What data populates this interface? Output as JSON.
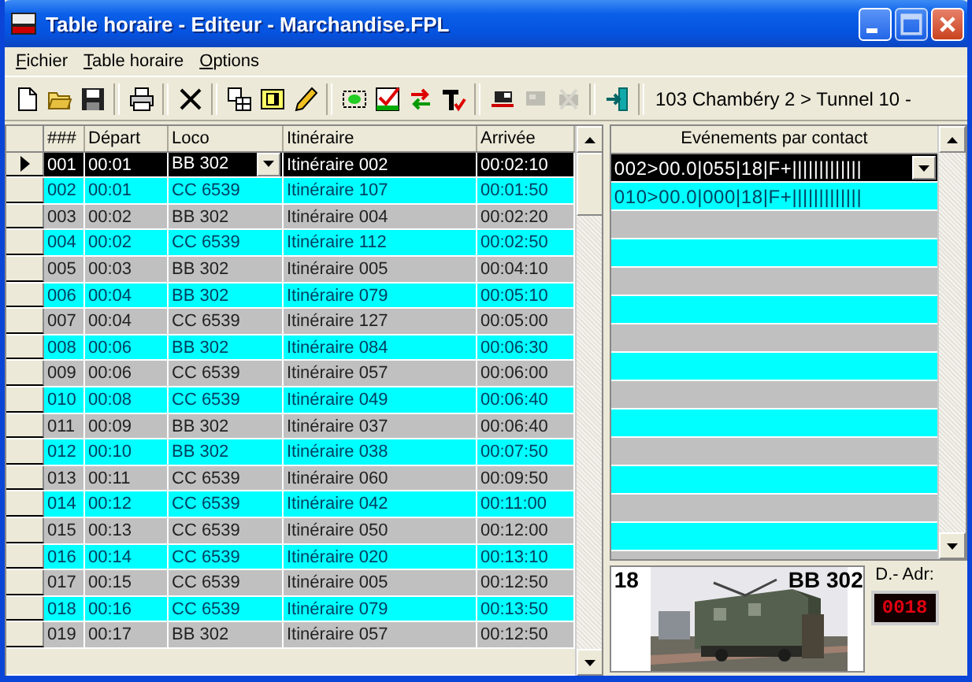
{
  "window": {
    "title": "Table horaire - Editeur - Marchandise.FPL"
  },
  "menu": [
    {
      "label": "Fichier"
    },
    {
      "label": "Table horaire"
    },
    {
      "label": "Options"
    }
  ],
  "toolbar": [
    [
      {
        "kind": "new",
        "disabled": false
      },
      {
        "kind": "open",
        "disabled": false
      },
      {
        "kind": "save",
        "disabled": false
      }
    ],
    [
      {
        "kind": "print",
        "disabled": false
      }
    ],
    [
      {
        "kind": "delete",
        "disabled": false
      }
    ],
    [
      {
        "kind": "table",
        "disabled": false
      },
      {
        "kind": "frame",
        "disabled": false
      },
      {
        "kind": "pencil",
        "disabled": false
      }
    ],
    [
      {
        "kind": "select",
        "disabled": false
      },
      {
        "kind": "check",
        "disabled": false
      },
      {
        "kind": "swap",
        "disabled": false
      },
      {
        "kind": "text",
        "disabled": false
      }
    ],
    [
      {
        "kind": "train",
        "disabled": false
      },
      {
        "kind": "train2",
        "disabled": true
      },
      {
        "kind": "train3",
        "disabled": true
      }
    ],
    [
      {
        "kind": "exit",
        "disabled": false
      }
    ]
  ],
  "route": "103 Chambéry 2 > Tunnel 10 -",
  "table": {
    "columns": [
      "###",
      "Départ",
      "Loco",
      "Itinéraire",
      "Arrivée"
    ],
    "rows": [
      {
        "cells": [
          "001",
          "00:01",
          "BB 302",
          "Itinéraire 002",
          "00:02:10"
        ],
        "selected": true
      },
      {
        "cells": [
          "002",
          "00:01",
          "CC 6539",
          "Itinéraire 107",
          "00:01:50"
        ],
        "selected": false
      },
      {
        "cells": [
          "003",
          "00:02",
          "BB 302",
          "Itinéraire 004",
          "00:02:20"
        ],
        "selected": false
      },
      {
        "cells": [
          "004",
          "00:02",
          "CC 6539",
          "Itinéraire 112",
          "00:02:50"
        ],
        "selected": false
      },
      {
        "cells": [
          "005",
          "00:03",
          "BB 302",
          "Itinéraire 005",
          "00:04:10"
        ],
        "selected": false
      },
      {
        "cells": [
          "006",
          "00:04",
          "BB 302",
          "Itinéraire 079",
          "00:05:10"
        ],
        "selected": false
      },
      {
        "cells": [
          "007",
          "00:04",
          "CC 6539",
          "Itinéraire 127",
          "00:05:00"
        ],
        "selected": false
      },
      {
        "cells": [
          "008",
          "00:06",
          "BB 302",
          "Itinéraire 084",
          "00:06:30"
        ],
        "selected": false
      },
      {
        "cells": [
          "009",
          "00:06",
          "CC 6539",
          "Itinéraire 057",
          "00:06:00"
        ],
        "selected": false
      },
      {
        "cells": [
          "010",
          "00:08",
          "CC 6539",
          "Itinéraire 049",
          "00:06:40"
        ],
        "selected": false
      },
      {
        "cells": [
          "011",
          "00:09",
          "BB 302",
          "Itinéraire 037",
          "00:06:40"
        ],
        "selected": false
      },
      {
        "cells": [
          "012",
          "00:10",
          "BB 302",
          "Itinéraire 038",
          "00:07:50"
        ],
        "selected": false
      },
      {
        "cells": [
          "013",
          "00:11",
          "CC 6539",
          "Itinéraire 060",
          "00:09:50"
        ],
        "selected": false
      },
      {
        "cells": [
          "014",
          "00:12",
          "CC 6539",
          "Itinéraire 042",
          "00:11:00"
        ],
        "selected": false
      },
      {
        "cells": [
          "015",
          "00:13",
          "CC 6539",
          "Itinéraire 050",
          "00:12:00"
        ],
        "selected": false
      },
      {
        "cells": [
          "016",
          "00:14",
          "CC 6539",
          "Itinéraire 020",
          "00:13:10"
        ],
        "selected": false
      },
      {
        "cells": [
          "017",
          "00:15",
          "CC 6539",
          "Itinéraire 005",
          "00:12:50"
        ],
        "selected": false
      },
      {
        "cells": [
          "018",
          "00:16",
          "CC 6539",
          "Itinéraire 079",
          "00:13:50"
        ],
        "selected": false
      },
      {
        "cells": [
          "019",
          "00:17",
          "BB 302",
          "Itinéraire 057",
          "00:12:50"
        ],
        "selected": false
      }
    ]
  },
  "events": {
    "title": "Evénements par contact",
    "items": [
      {
        "text": "002>00.0|055|18|F+|||||||||||||",
        "selected": true
      },
      {
        "text": "010>00.0|000|18|F+|||||||||||||",
        "selected": false
      }
    ]
  },
  "loco": {
    "number": "18",
    "name": "BB 302",
    "address_label": "D.- Adr:",
    "address": "0018"
  }
}
